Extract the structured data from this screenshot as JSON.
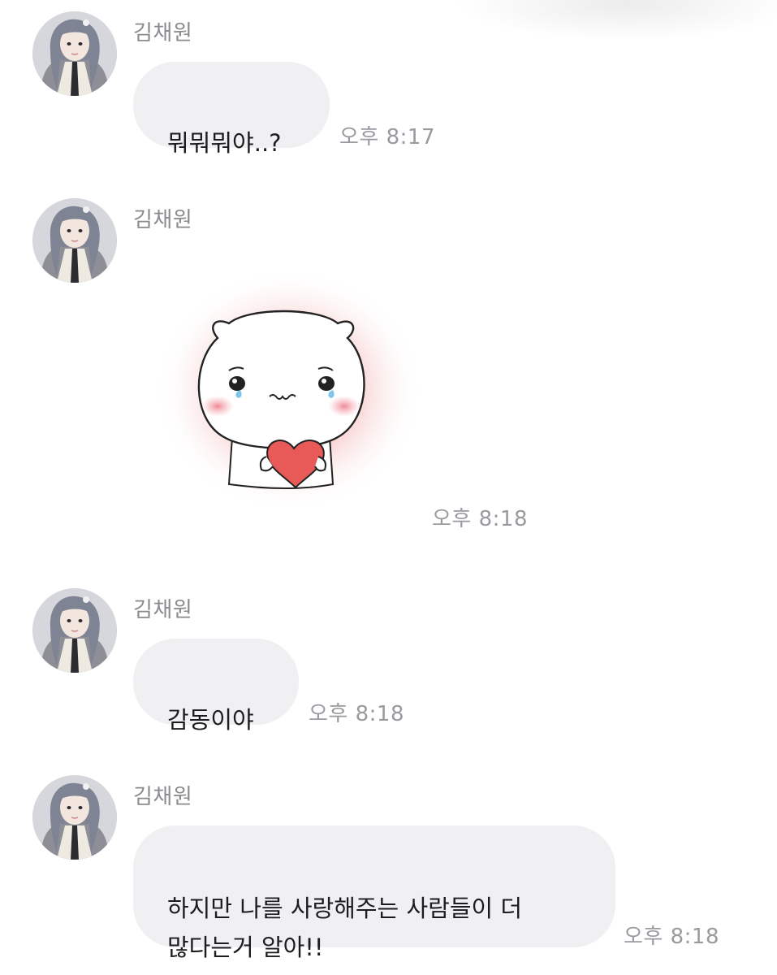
{
  "chat": {
    "messages": [
      {
        "sender": "김채원",
        "type": "text",
        "text": "뭐뭐뭐야..?",
        "time": "오후 8:17"
      },
      {
        "sender": "김채원",
        "type": "sticker",
        "sticker_icon": "crying-hamster-holding-heart-icon",
        "time": "오후 8:18"
      },
      {
        "sender": "김채원",
        "type": "text",
        "text": "감동이야",
        "time": "오후 8:18"
      },
      {
        "sender": "김채원",
        "type": "text",
        "text": "하지만 나를 사랑해주는 사람들이 더\n많다는거 알아!!",
        "time": "오후 8:18"
      }
    ]
  },
  "colors": {
    "bubble": "#f0f0f3",
    "sender_name": "#8a8a8f",
    "timestamp": "#9a9aa0",
    "message_text": "#1c1c1e",
    "sticker_glow": "#f4b8b8",
    "heart": "#e85a57"
  }
}
